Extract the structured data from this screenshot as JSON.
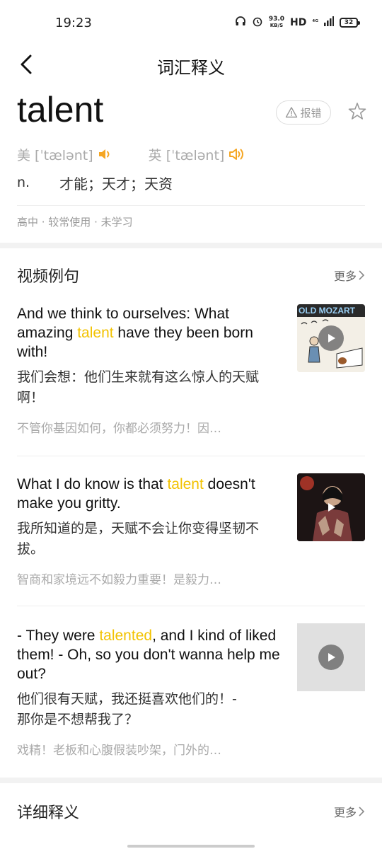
{
  "status": {
    "time": "19:23",
    "net_speed_value": "93.0",
    "net_speed_unit": "KB/S",
    "hd": "HD",
    "signal": "⁴ᴳ",
    "battery": "32"
  },
  "header": {
    "title": "词汇释义"
  },
  "word": {
    "text": "talent",
    "report_label": "报错",
    "us_label": "美 [ˈtælənt]",
    "uk_label": "英 [ˈtælənt]",
    "pos": "n.",
    "definition": "才能；天才；天资",
    "tags": "高中 · 较常使用 · 未学习"
  },
  "video_examples": {
    "title": "视频例句",
    "more": "更多",
    "items": [
      {
        "en_before": "And we think to ourselves: What amazing ",
        "en_highlight": "talent",
        "en_after": " have they been born with!",
        "cn": "我们会想：他们生来就有这么惊人的天赋啊！",
        "source": "不管你基因如何，你都必须努力！因…",
        "thumb_caption": "OLD MOZART"
      },
      {
        "en_before": "What I do know is that ",
        "en_highlight": "talent",
        "en_after": " doesn't make you gritty.",
        "cn": "我所知道的是，天赋不会让你变得坚韧不拔。",
        "source": "智商和家境远不如毅力重要！是毅力…"
      },
      {
        "en_before": "- They were ",
        "en_highlight": "talented",
        "en_after": ", and I kind of liked them! - Oh, so you don't wanna help me out?",
        "cn": "他们很有天赋，我还挺喜欢他们的！- 那你是不想帮我了？",
        "source": "戏精！老板和心腹假装吵架，门外的…"
      }
    ]
  },
  "details": {
    "title": "详细释义",
    "more": "更多"
  },
  "colors": {
    "highlight": "#f2c200",
    "speaker": "#f5a623"
  }
}
